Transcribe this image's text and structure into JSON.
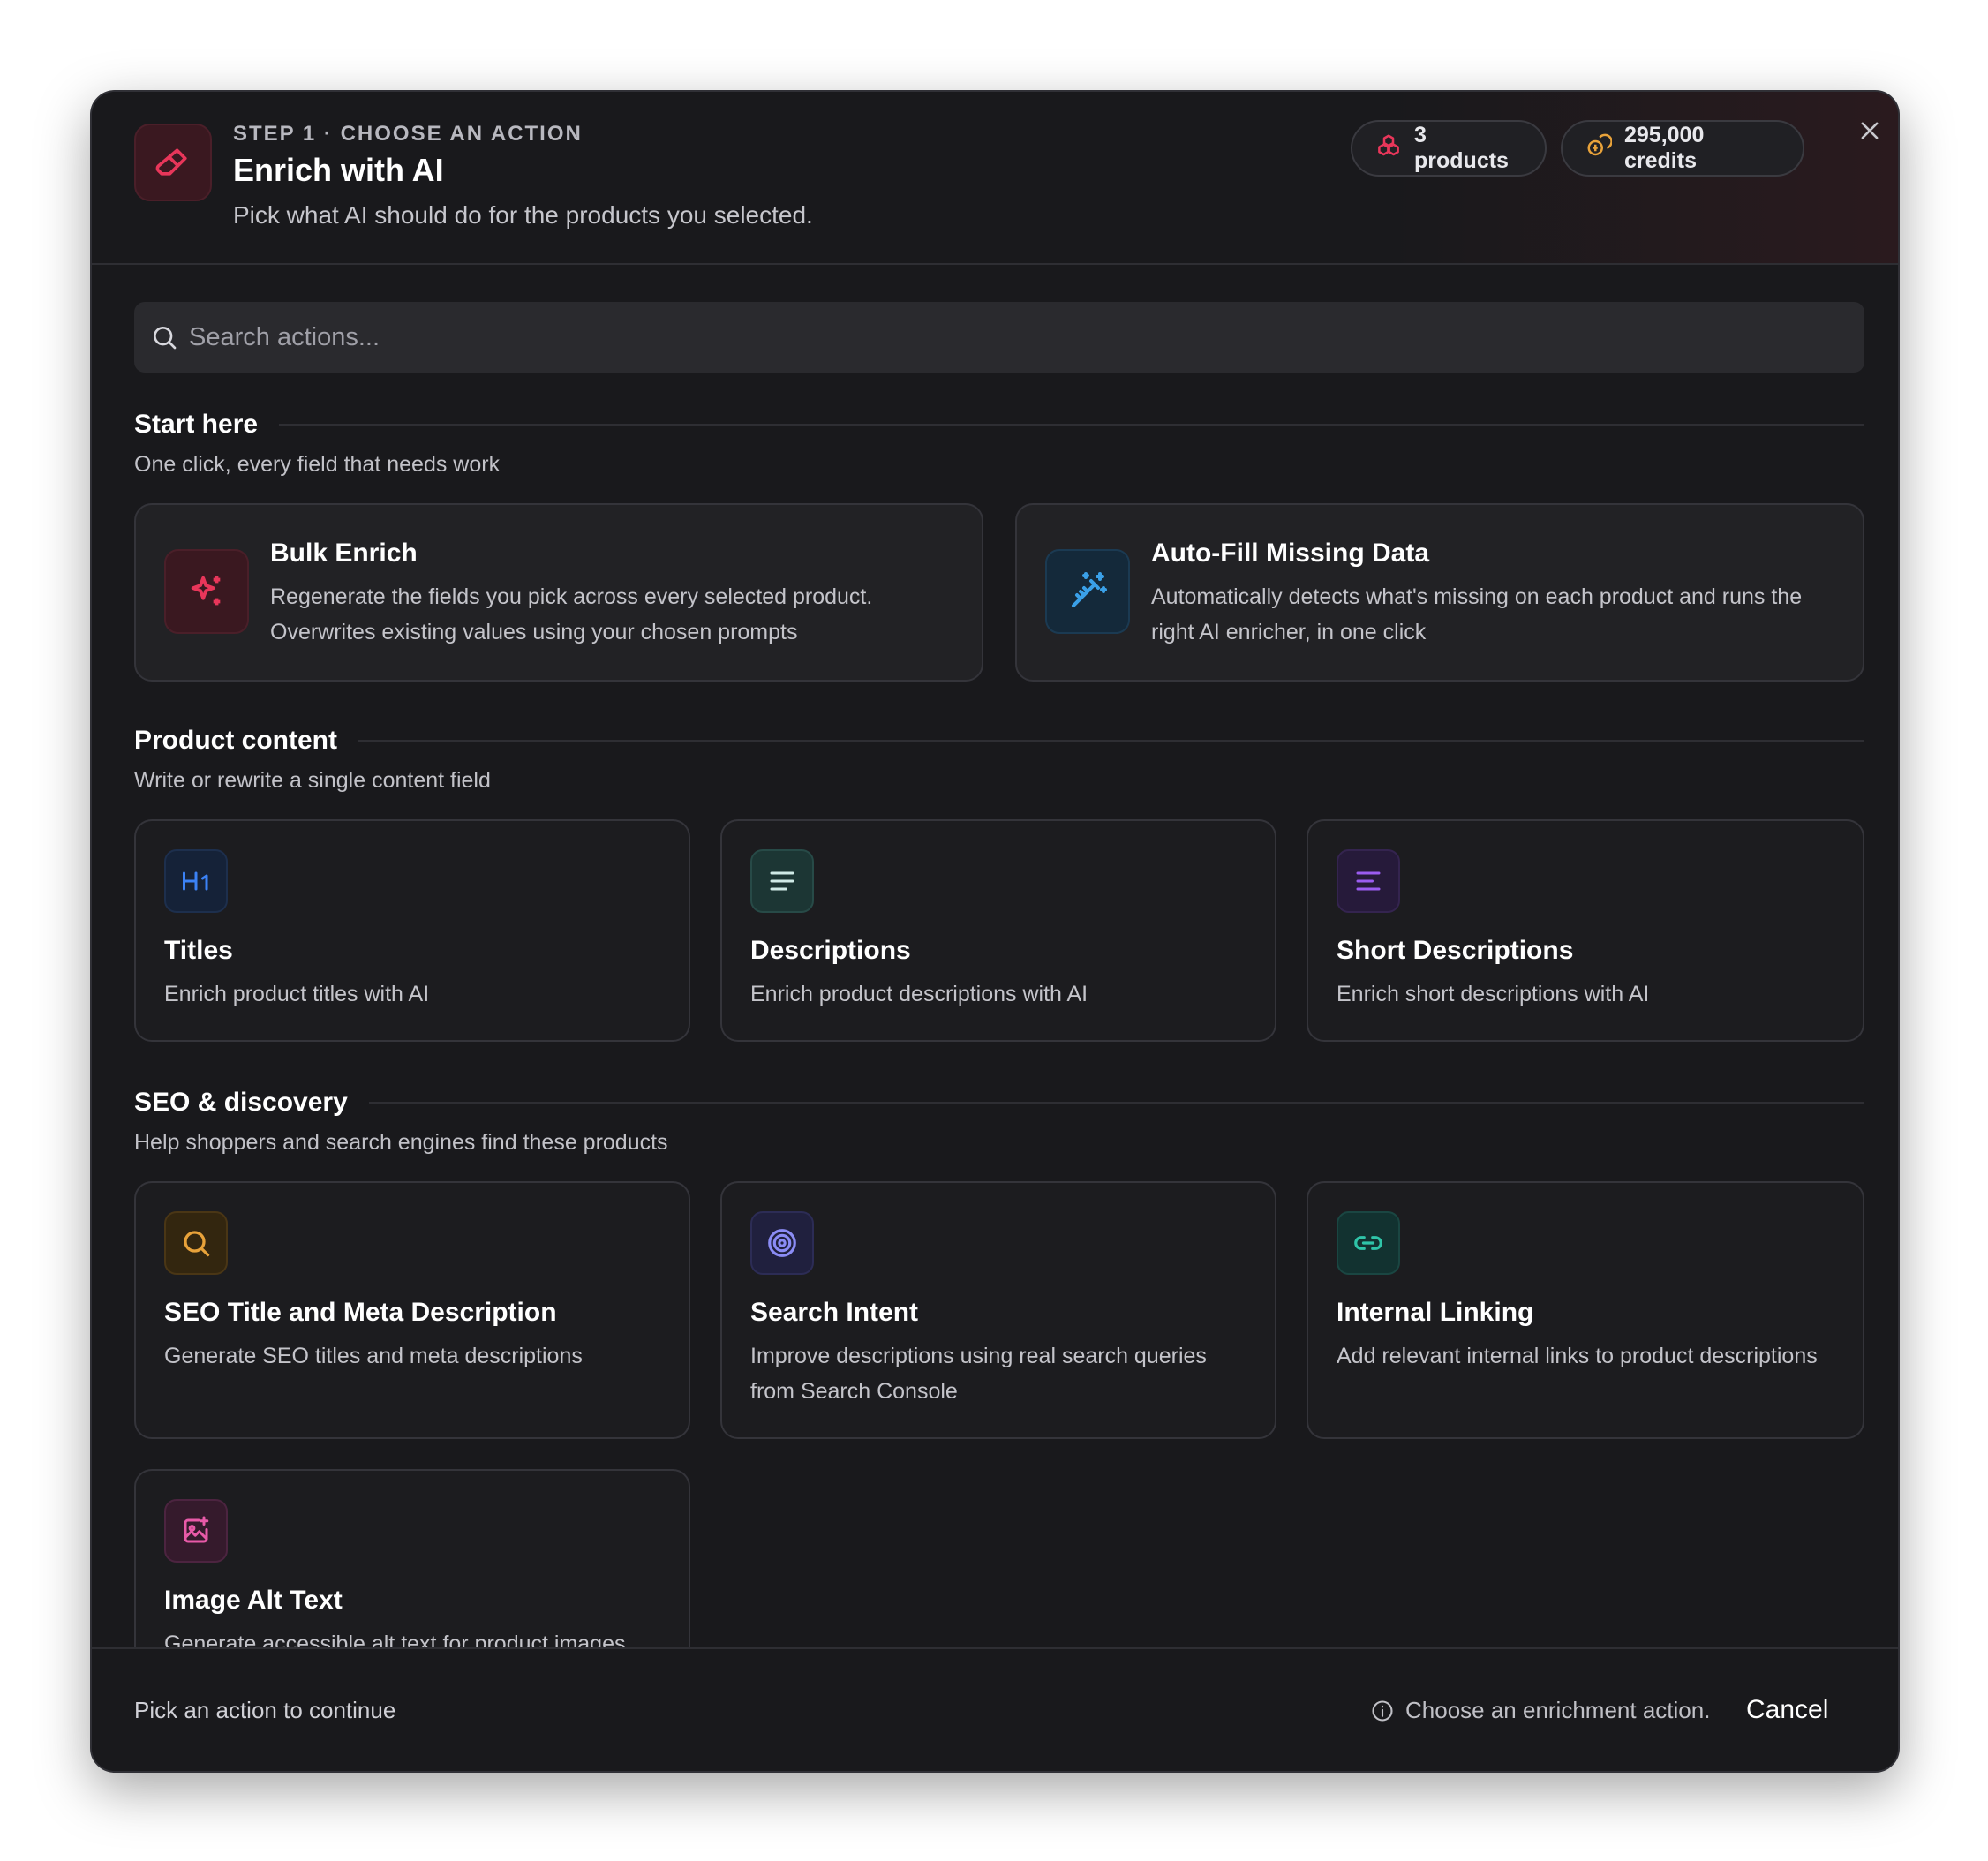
{
  "header": {
    "step_label": "STEP 1 · CHOOSE AN ACTION",
    "title": "Enrich with AI",
    "subtitle": "Pick what AI should do for the products you selected.",
    "products_badge": "3 products",
    "credits_badge": "295,000 credits",
    "icon": "eraser-icon"
  },
  "search": {
    "placeholder": "Search actions..."
  },
  "sections": {
    "start": {
      "title": "Start here",
      "subtitle": "One click, every field that needs work",
      "cards": [
        {
          "title": "Bulk Enrich",
          "description": "Regenerate the fields you pick across every selected product. Overwrites existing values using your chosen prompts",
          "icon": "sparkles-icon",
          "color": "#e8365a"
        },
        {
          "title": "Auto-Fill Missing Data",
          "description": "Automatically detects what's missing on each product and runs the right AI enricher, in one click",
          "icon": "magic-wand-icon",
          "color": "#3aa0e8"
        }
      ]
    },
    "content": {
      "title": "Product content",
      "subtitle": "Write or rewrite a single content field",
      "cards": [
        {
          "title": "Titles",
          "description": "Enrich product titles with AI",
          "icon": "heading-1-icon",
          "color": "#3b82f6"
        },
        {
          "title": "Descriptions",
          "description": "Enrich product descriptions with AI",
          "icon": "align-left-icon",
          "color": "#7fd1c8"
        },
        {
          "title": "Short Descriptions",
          "description": "Enrich short descriptions with AI",
          "icon": "text-short-icon",
          "color": "#9b5cf0"
        }
      ]
    },
    "seo": {
      "title": "SEO & discovery",
      "subtitle": "Help shoppers and search engines find these products",
      "cards": [
        {
          "title": "SEO Title and Meta Description",
          "description": "Generate SEO titles and meta descriptions",
          "icon": "search-icon",
          "color": "#e8a23a"
        },
        {
          "title": "Search Intent",
          "description": "Improve descriptions using real search queries from Search Console",
          "icon": "target-icon",
          "color": "#8b8cf5"
        },
        {
          "title": "Internal Linking",
          "description": "Add relevant internal links to product descriptions",
          "icon": "link-icon",
          "color": "#2fc4a8"
        },
        {
          "title": "Image Alt Text",
          "description": "Generate accessible alt text for product images",
          "icon": "image-plus-icon",
          "color": "#e85aa8"
        }
      ]
    }
  },
  "footer": {
    "status": "Pick an action to continue",
    "hint": "Choose an enrichment action.",
    "cancel_label": "Cancel"
  }
}
